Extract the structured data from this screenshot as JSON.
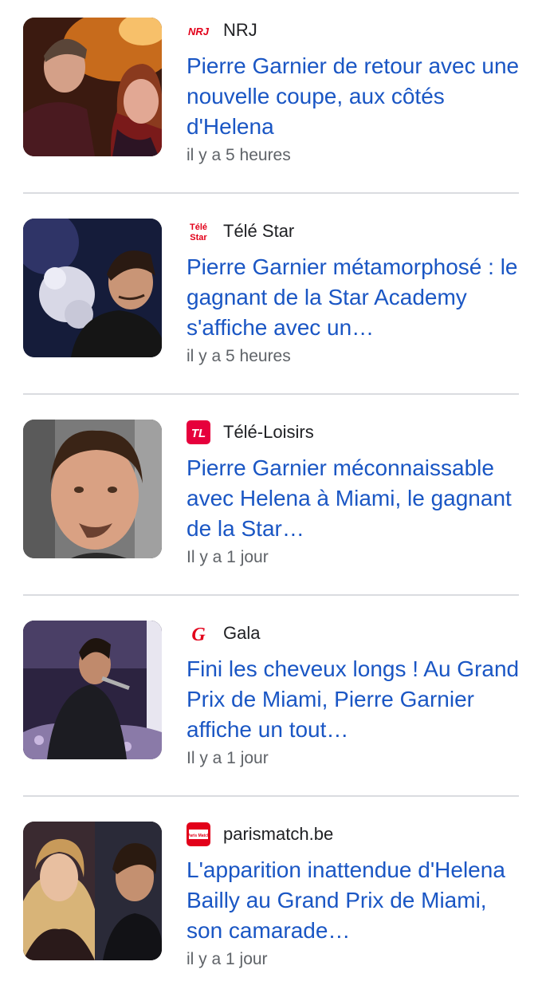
{
  "articles": [
    {
      "source": "NRJ",
      "source_logo_icon": "nrj-logo-icon",
      "source_logo_text": "NRJ",
      "headline": "Pierre Garnier de retour avec une nouvelle coupe, aux côtés d'Helena",
      "time": "il y a 5 heures",
      "thumbnail_icon": "article-thumbnail"
    },
    {
      "source": "Télé Star",
      "source_logo_icon": "tele-star-logo-icon",
      "source_logo_text": "Télé Star",
      "headline": "Pierre Garnier métamorphosé : le gagnant de la Star Academy s'affiche avec un…",
      "time": "il y a 5 heures",
      "thumbnail_icon": "article-thumbnail"
    },
    {
      "source": "Télé-Loisirs",
      "source_logo_icon": "tele-loisirs-logo-icon",
      "source_logo_text": "TL",
      "headline": "Pierre Garnier méconnaissable avec Helena à Miami, le gagnant de la Star…",
      "time": "Il y a 1 jour",
      "thumbnail_icon": "article-thumbnail"
    },
    {
      "source": "Gala",
      "source_logo_icon": "gala-logo-icon",
      "source_logo_text": "G",
      "headline": "Fini les cheveux longs ! Au Grand Prix de Miami, Pierre Garnier affiche un tout…",
      "time": "Il y a 1 jour",
      "thumbnail_icon": "article-thumbnail"
    },
    {
      "source": "parismatch.be",
      "source_logo_icon": "paris-match-logo-icon",
      "source_logo_text": "Paris Match",
      "headline": "L'apparition inattendue d'Helena Bailly au Grand Prix de Miami, son camarade…",
      "time": "il y a 1 jour",
      "thumbnail_icon": "article-thumbnail"
    }
  ],
  "colors": {
    "headline": "#1a56c4",
    "source": "#202124",
    "time": "#5f6368",
    "divider": "#dadce0"
  }
}
